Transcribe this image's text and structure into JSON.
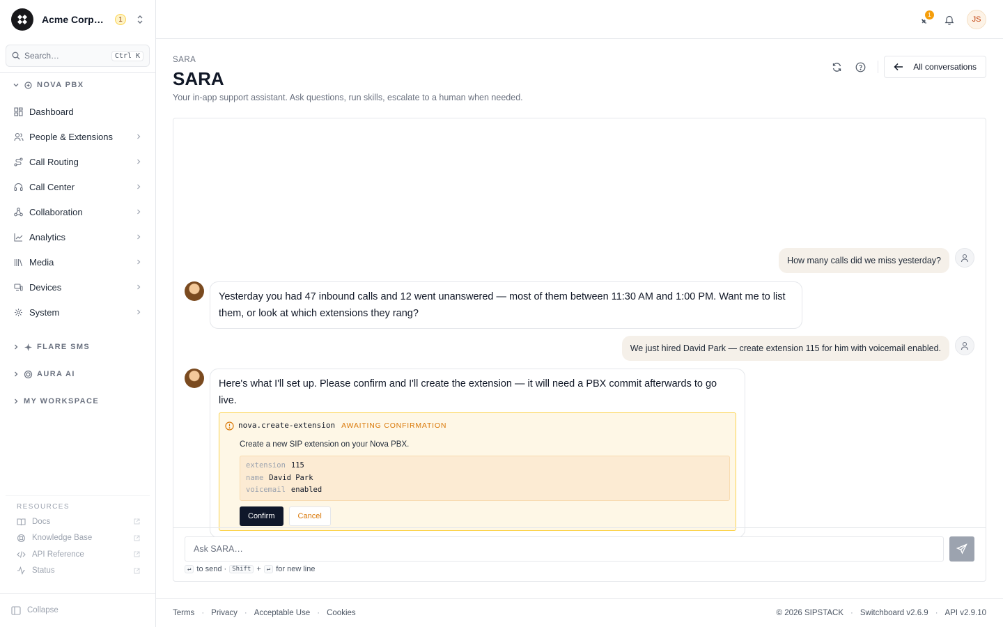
{
  "org": {
    "name": "Acme Corporation",
    "badge": "1"
  },
  "search": {
    "placeholder": "Search…",
    "shortcut": "Ctrl K"
  },
  "nav": {
    "nova": {
      "title": "NOVA PBX",
      "items": [
        {
          "label": "Dashboard",
          "icon": "dashboard-icon"
        },
        {
          "label": "People & Extensions",
          "icon": "people-icon"
        },
        {
          "label": "Call Routing",
          "icon": "routing-icon"
        },
        {
          "label": "Call Center",
          "icon": "headset-icon"
        },
        {
          "label": "Collaboration",
          "icon": "collaboration-icon"
        },
        {
          "label": "Analytics",
          "icon": "analytics-icon"
        },
        {
          "label": "Media",
          "icon": "media-icon"
        },
        {
          "label": "Devices",
          "icon": "devices-icon"
        },
        {
          "label": "System",
          "icon": "system-icon"
        }
      ]
    },
    "flare": {
      "title": "FLARE SMS"
    },
    "aura": {
      "title": "AURA AI"
    },
    "workspace": {
      "title": "MY WORKSPACE"
    }
  },
  "resources": {
    "title": "RESOURCES",
    "items": [
      {
        "label": "Docs"
      },
      {
        "label": "Knowledge Base"
      },
      {
        "label": "API Reference"
      },
      {
        "label": "Status"
      }
    ]
  },
  "collapse": {
    "label": "Collapse"
  },
  "topbar": {
    "notification_count": "1",
    "user_initials": "JS"
  },
  "page": {
    "breadcrumb": "SARA",
    "title": "SARA",
    "subtitle": "Your in-app support assistant. Ask questions, run skills, escalate to a human when needed.",
    "all_conversations": "All conversations"
  },
  "chat": {
    "messages": [
      {
        "role": "user",
        "text": "How many calls did we miss yesterday?"
      },
      {
        "role": "assistant",
        "text": "Yesterday you had 47 inbound calls and 12 went unanswered — most of them between 11:30 AM and 1:00 PM. Want me to list them, or look at which extensions they rang?"
      },
      {
        "role": "user",
        "text": "We just hired David Park — create extension 115 for him with voicemail enabled."
      },
      {
        "role": "assistant",
        "text": "Here's what I'll set up. Please confirm and I'll create the extension — it will need a PBX commit afterwards to go live."
      }
    ],
    "tool_call": {
      "name": "nova.create-extension",
      "status": "AWAITING CONFIRMATION",
      "description": "Create a new SIP extension on your Nova PBX.",
      "params": [
        {
          "key": "extension",
          "value": "115"
        },
        {
          "key": "name",
          "value": "David Park"
        },
        {
          "key": "voicemail",
          "value": "enabled"
        }
      ],
      "confirm_label": "Confirm",
      "cancel_label": "Cancel"
    },
    "composer": {
      "placeholder": "Ask SARA…",
      "enter_key": "↵",
      "to_send": "to send ·",
      "shift_key": "Shift",
      "plus": "+",
      "newline_key": "↵",
      "for_new_line": "for new line"
    }
  },
  "footer": {
    "links": [
      "Terms",
      "Privacy",
      "Acceptable Use",
      "Cookies"
    ],
    "copyright": "© 2026 SIPSTACK",
    "switchboard_version": "Switchboard v2.6.9",
    "api_version": "API v2.9.10"
  },
  "colors": {
    "accent": "#d97706",
    "primary": "#0f172a",
    "tool_bg": "#fef7e6"
  }
}
